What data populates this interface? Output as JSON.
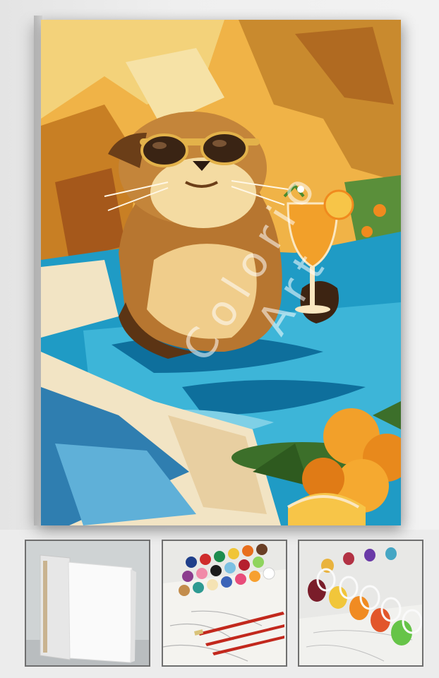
{
  "product_image": {
    "subject": "otter-in-pool-with-cocktail-painting",
    "watermark": "Colorio Art",
    "palette": [
      "#f0b347",
      "#c87f24",
      "#1f9bc5",
      "#f2e4c4",
      "#f2a02a",
      "#5b3414"
    ]
  },
  "thumbnails": [
    {
      "subject": "blank-stretched-canvas"
    },
    {
      "subject": "paint-pots-and-brushes"
    },
    {
      "subject": "open-paint-pots-closeup"
    }
  ]
}
